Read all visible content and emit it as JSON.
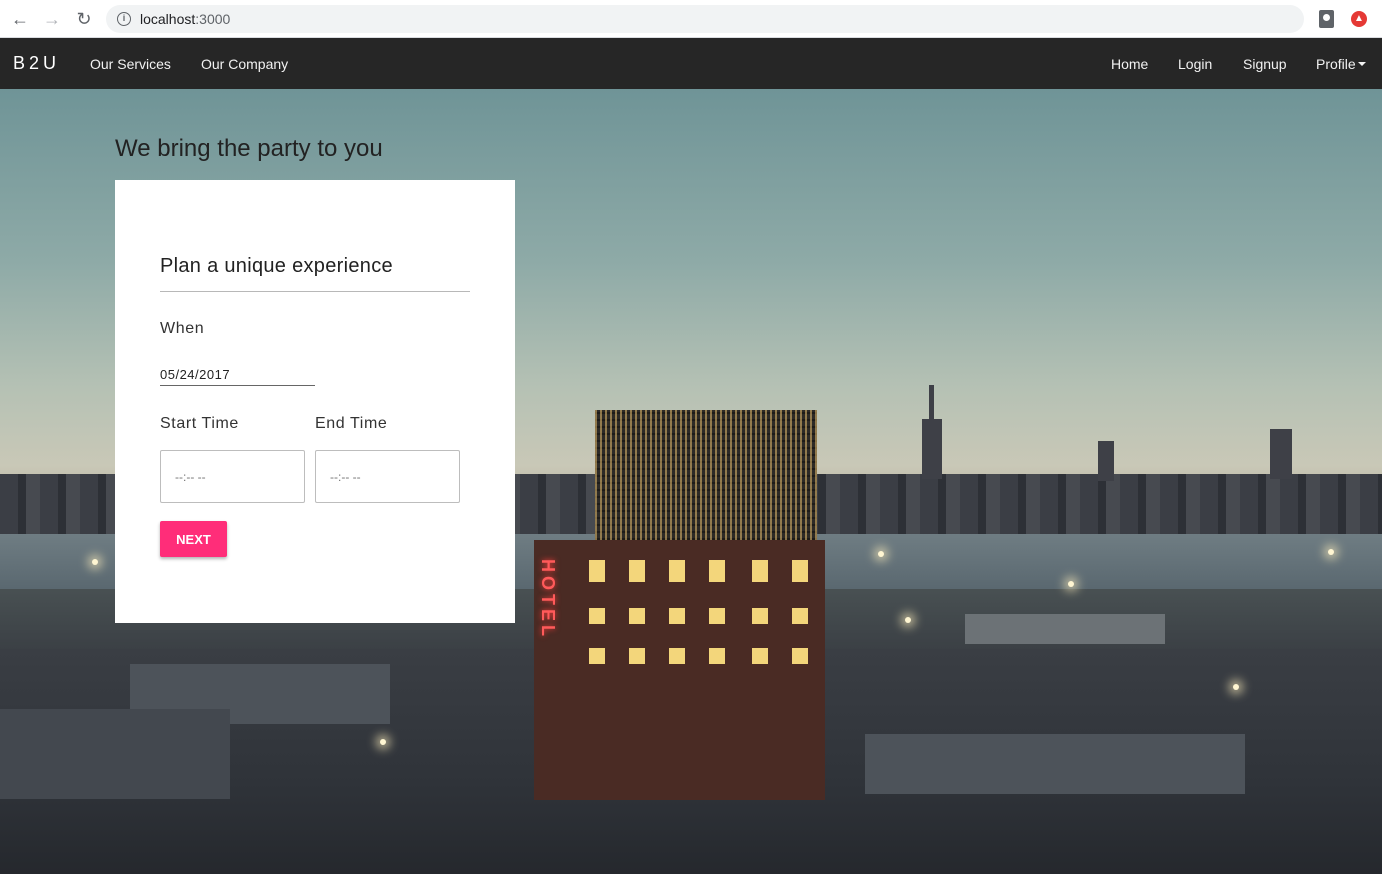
{
  "browser": {
    "url_host": "localhost",
    "url_port": ":3000"
  },
  "navbar": {
    "brand": "B2U",
    "left_links": [
      "Our Services",
      "Our Company"
    ],
    "right_links": [
      "Home",
      "Login",
      "Signup"
    ],
    "profile_label": "Profile"
  },
  "hero": {
    "tagline": "We bring the party to you",
    "hotel_sign": "HOTEL"
  },
  "form": {
    "title": "Plan a unique experience",
    "when_label": "When",
    "date_value": "05/24/2017",
    "start_label": "Start Time",
    "end_label": "End Time",
    "start_placeholder": "--:-- --",
    "end_placeholder": "--:-- --",
    "next_label": "NEXT"
  },
  "colors": {
    "navbar_bg": "#262626",
    "accent": "#ff2d79"
  }
}
